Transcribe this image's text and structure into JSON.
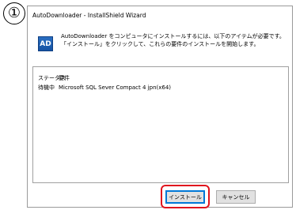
{
  "annotation": {
    "step_number": "①"
  },
  "window": {
    "title": "AutoDownloader - InstallShield Wizard"
  },
  "header": {
    "icon_text": "AD",
    "message": "AutoDownloader をコンピュータにインストールするには、以下のアイテムが必要です。「インストール」をクリックして、これらの要件のインストールを開始します。"
  },
  "requirements": {
    "headers": {
      "status": "ステータス",
      "item": "要件"
    },
    "rows": [
      {
        "status": "待機中",
        "item": "Microsoft SQL Sever Compact 4 jpn(x64)"
      }
    ]
  },
  "buttons": {
    "install": "インストール",
    "cancel": "キャンセル"
  },
  "colors": {
    "highlight": "#e0141e",
    "focus_border": "#0078d7",
    "icon_blue": "#1552a3"
  }
}
